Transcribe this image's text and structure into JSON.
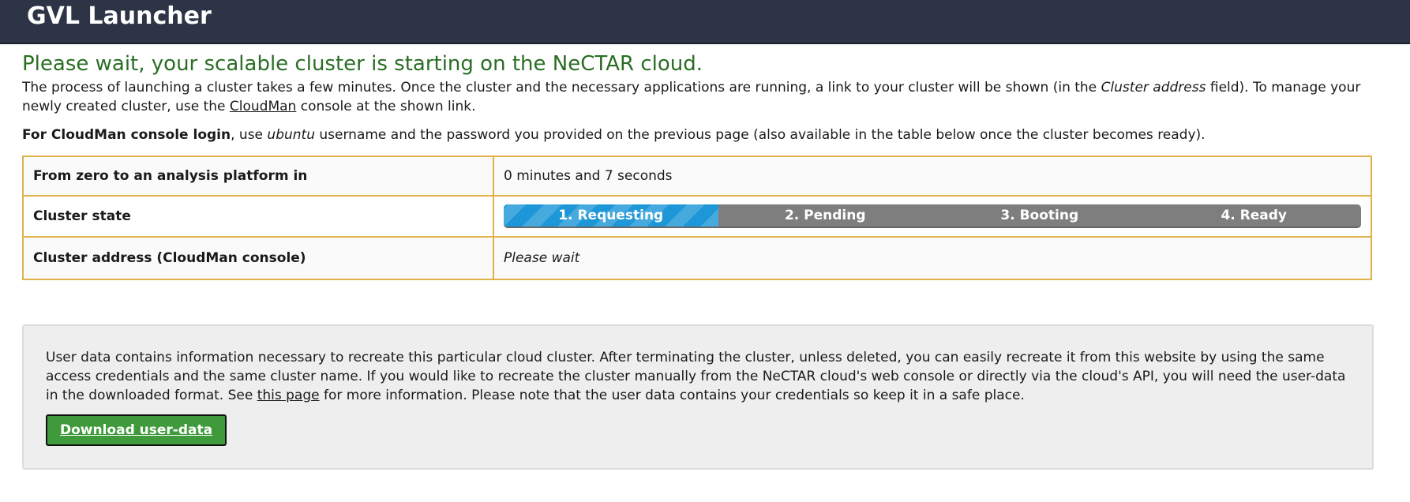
{
  "header": {
    "title": "GVL Launcher"
  },
  "main": {
    "heading": "Please wait, your scalable cluster is starting on the NeCTAR cloud.",
    "intro": {
      "part1": "The process of launching a cluster takes a few minutes. Once the cluster and the necessary applications are running, a link to your cluster will be shown (in the ",
      "italic": "Cluster address",
      "part2": " field). To manage your newly created cluster, use the ",
      "link": "CloudMan",
      "part3": " console at the shown link."
    },
    "login": {
      "bold": "For CloudMan console login",
      "part1": ", use ",
      "italic": "ubuntu",
      "part2": " username and the password you provided on the previous page (also available in the table below once the cluster becomes ready)."
    }
  },
  "table": {
    "rows": [
      {
        "label": "From zero to an analysis platform in",
        "value": "0 minutes and 7 seconds"
      },
      {
        "label": "Cluster state"
      },
      {
        "label": "Cluster address (CloudMan console)",
        "value": "Please wait"
      }
    ],
    "steps": [
      "1. Requesting",
      "2. Pending",
      "3. Booting",
      "4. Ready"
    ],
    "active_step": 1
  },
  "userdata": {
    "part1": "User data contains information necessary to recreate this particular cloud cluster. After terminating the cluster, unless deleted, you can easily recreate it from this website by using the same access credentials and the same cluster name. If you would like to recreate the cluster manually from the NeCTAR cloud's web console or directly via the cloud's API, you will need the user-data in the downloaded format. See ",
    "link": "this page",
    "part2": " for more information. Please note that the user data contains your credentials so keep it in a safe place.",
    "button": "Download user-data"
  },
  "colors": {
    "header_bg": "#2c3446",
    "heading": "#2a6e24",
    "table_border": "#e0b24c",
    "progress_active": "#1e97d8",
    "progress_inactive": "#7e7e7e",
    "button_bg": "#3e9a3a"
  }
}
